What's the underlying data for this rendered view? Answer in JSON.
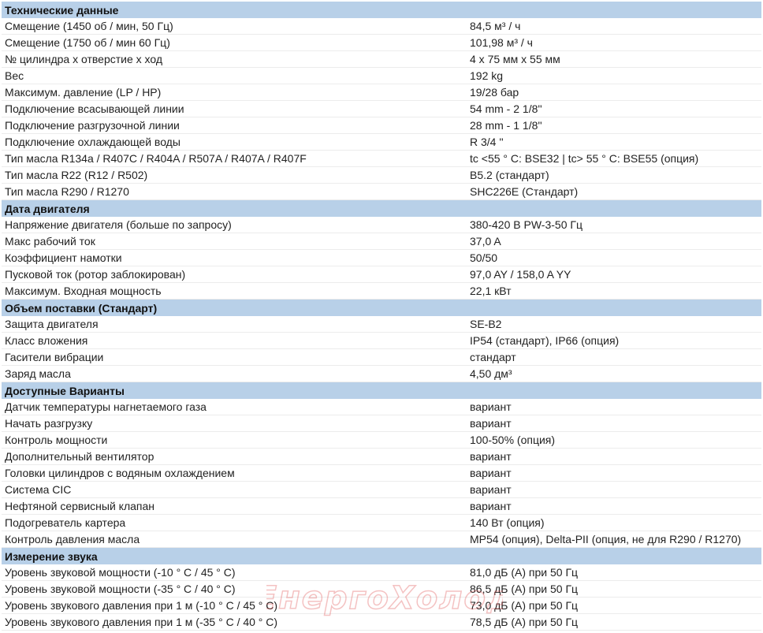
{
  "sections": [
    {
      "title": "Технические данные",
      "rows": [
        {
          "label": "Смещение (1450 об / мин, 50 Гц)",
          "value": "84,5 м³ / ч"
        },
        {
          "label": "Смещение (1750 об / мин 60 Гц)",
          "value": "101,98 м³ / ч"
        },
        {
          "label": "№ цилиндра x отверстие x ход",
          "value": "4 x 75 мм x 55 мм"
        },
        {
          "label": "Вес",
          "value": "192 kg"
        },
        {
          "label": "Максимум. давление (LP / HP)",
          "value": "19/28 бар"
        },
        {
          "label": "Подключение всасывающей линии",
          "value": "54 mm - 2 1/8''"
        },
        {
          "label": "Подключение разгрузочной линии",
          "value": "28 mm - 1 1/8''"
        },
        {
          "label": "Подключение охлаждающей воды",
          "value": "R 3/4 ''"
        },
        {
          "label": "Тип масла R134a / R407C / R404A / R507A / R407A / R407F",
          "value": "tc <55 ° C: BSE32 | tc> 55 ° C: BSE55 (опция)"
        },
        {
          "label": "Тип масла R22 (R12 / R502)",
          "value": "B5.2 (стандарт)"
        },
        {
          "label": "Тип масла R290 / R1270",
          "value": "SHC226E (Стандарт)"
        }
      ]
    },
    {
      "title": "Дата двигателя",
      "rows": [
        {
          "label": "Напряжение двигателя (больше по запросу)",
          "value": "380-420 В PW-3-50 Гц"
        },
        {
          "label": "Макс рабочий ток",
          "value": "37,0 A"
        },
        {
          "label": "Коэффициент намотки",
          "value": "50/50"
        },
        {
          "label": "Пусковой ток (ротор заблокирован)",
          "value": "97,0 AY / 158,0 A YY"
        },
        {
          "label": "Максимум. Входная мощность",
          "value": "22,1 кВт"
        }
      ]
    },
    {
      "title": "Объем поставки (Стандарт)",
      "rows": [
        {
          "label": "Защита двигателя",
          "value": "SE-B2"
        },
        {
          "label": "Класс вложения",
          "value": "IP54 (стандарт), IP66 (опция)"
        },
        {
          "label": "Гасители вибрации",
          "value": "стандарт"
        },
        {
          "label": "Заряд масла",
          "value": "4,50 дм³"
        }
      ]
    },
    {
      "title": "Доступные Варианты",
      "rows": [
        {
          "label": "Датчик температуры нагнетаемого газа",
          "value": "вариант"
        },
        {
          "label": "Начать разгрузку",
          "value": "вариант"
        },
        {
          "label": "Контроль мощности",
          "value": "100-50% (опция)"
        },
        {
          "label": "Дополнительный вентилятор",
          "value": "вариант"
        },
        {
          "label": "Головки цилиндров с водяным охлаждением",
          "value": "вариант"
        },
        {
          "label": "Система CIC",
          "value": "вариант"
        },
        {
          "label": "Нефтяной сервисный клапан",
          "value": "вариант"
        },
        {
          "label": "Подогреватель картера",
          "value": "140 Вт (опция)"
        },
        {
          "label": "Контроль давления масла",
          "value": "MP54 (опция), Delta-PII (опция, не для R290 / R1270)"
        }
      ]
    },
    {
      "title": "Измерение звука",
      "rows": [
        {
          "label": "Уровень звуковой мощности (-10 ° C / 45 ° C)",
          "value": "81,0 дБ (A) при 50 Гц"
        },
        {
          "label": "Уровень звуковой мощности (-35 ° C / 40 ° C)",
          "value": "86,5 дБ (A) при 50 Гц"
        },
        {
          "label": "Уровень звукового давления при 1 м (-10 ° C / 45 ° C)",
          "value": "73,0 дБ (A) при 50 Гц"
        },
        {
          "label": "Уровень звукового давления при 1 м (-35 ° C / 40 ° C)",
          "value": "78,5 дБ (A) при 50 Гц"
        }
      ]
    }
  ],
  "watermark": {
    "text": "ЕнергоХолод",
    "color": "#e05050"
  },
  "colors": {
    "section_header_bg": "#b8d0e8",
    "row_border": "#ececec"
  }
}
